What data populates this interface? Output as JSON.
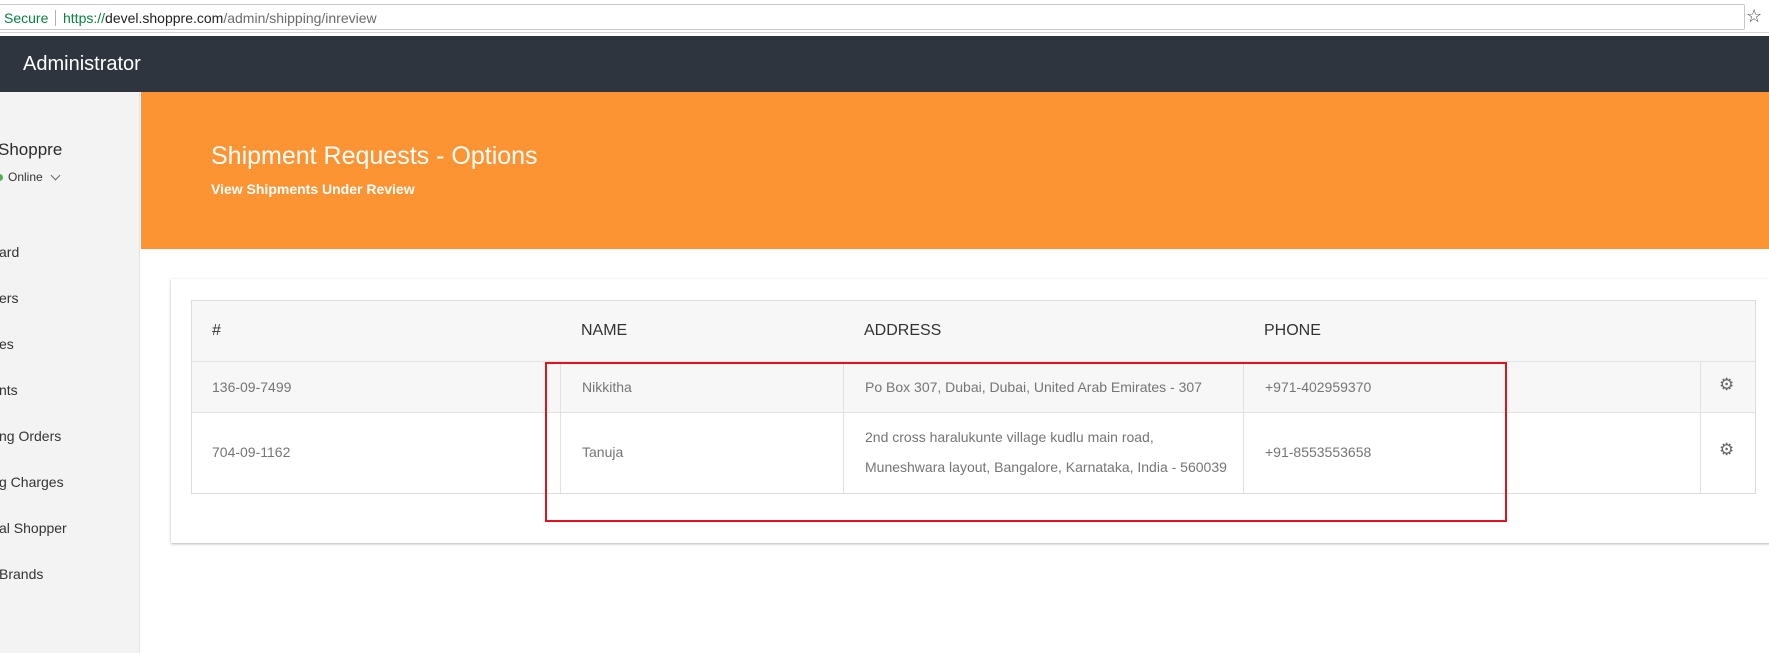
{
  "browser": {
    "secure_label": "Secure",
    "url_scheme": "https://",
    "url_host": "devel.shoppre.com",
    "url_path": "/admin/shipping/inreview",
    "bookmark_icon": "star-icon"
  },
  "topbar": {
    "title": "Administrator"
  },
  "sidebar": {
    "user_name": "Shoppre",
    "status": "Online",
    "items": [
      {
        "label": "ard"
      },
      {
        "label": "ers"
      },
      {
        "label": "es"
      },
      {
        "label": "nts"
      },
      {
        "label": "ng Orders"
      },
      {
        "label": "g Charges"
      },
      {
        "label": "al Shopper"
      },
      {
        "label": "Brands"
      }
    ]
  },
  "header": {
    "title": "Shipment Requests - Options",
    "subtitle": "View Shipments Under Review"
  },
  "table": {
    "columns": [
      "#",
      "NAME",
      "ADDRESS",
      "PHONE"
    ],
    "rows": [
      {
        "id": "136-09-7499",
        "name": "Nikkitha",
        "address_line1": "Po Box 307, Dubai, Dubai, United Arab Emirates - 307",
        "address_line2": "",
        "phone": "+971-402959370",
        "action_icon": "gear-icon"
      },
      {
        "id": "704-09-1162",
        "name": "Tanuja",
        "address_line1": "2nd cross haralukunte village kudlu main road,",
        "address_line2": "Muneshwara layout, Bangalore, Karnataka, India - 560039",
        "phone": "+91-8553553658",
        "action_icon": "gear-icon"
      }
    ]
  },
  "colors": {
    "topbar": "#2f353f",
    "header": "#fd9433",
    "highlight": "#e0141e",
    "secure": "#0b8043"
  }
}
